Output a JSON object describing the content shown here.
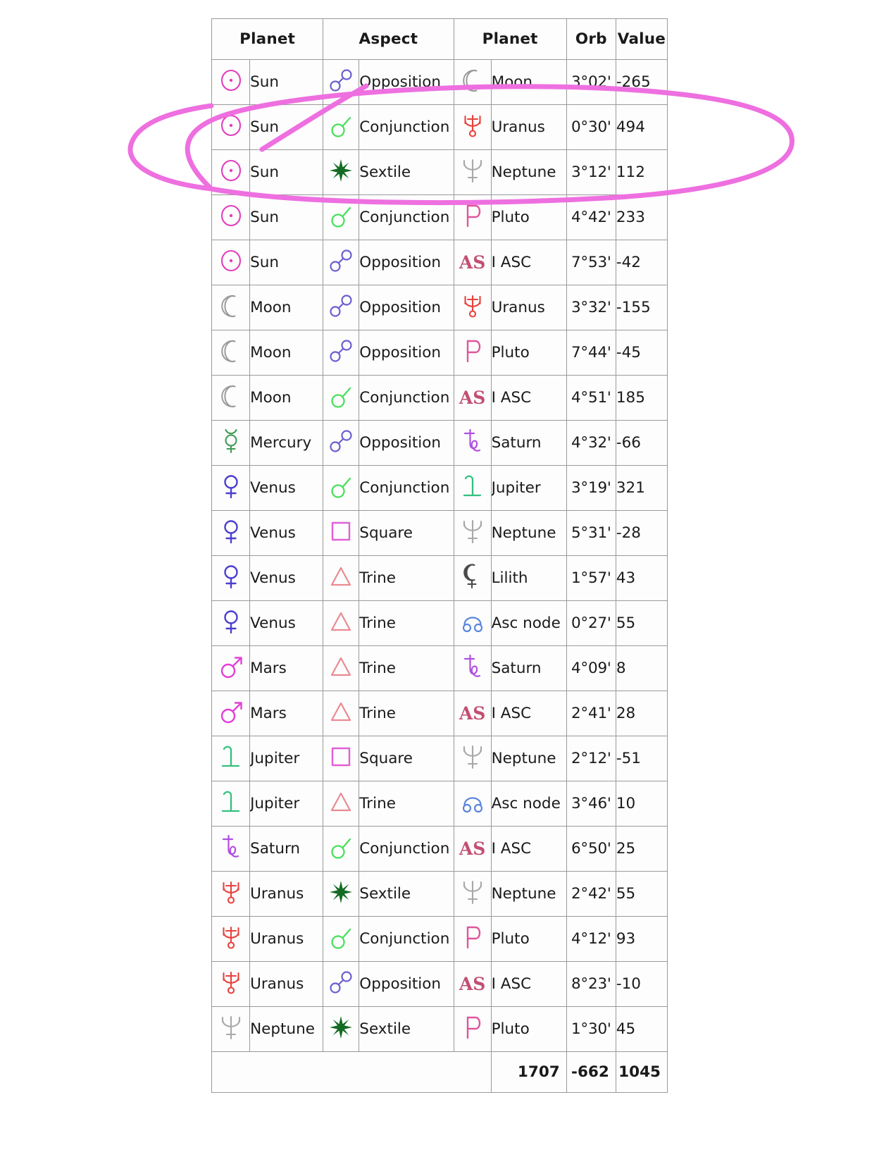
{
  "table": {
    "headers": [
      "Planet",
      "Aspect",
      "Planet",
      "Orb",
      "Value"
    ],
    "rows": [
      {
        "sym1": "sun",
        "planet1": "Sun",
        "aspect_sym": "opposition",
        "aspect": "Opposition",
        "sym2": "moon",
        "planet2": "Moon",
        "orb": "3°02'",
        "value": "-265"
      },
      {
        "sym1": "sun",
        "planet1": "Sun",
        "aspect_sym": "conjunction",
        "aspect": "Conjunction",
        "sym2": "uranus",
        "planet2": "Uranus",
        "orb": "0°30'",
        "value": "494"
      },
      {
        "sym1": "sun",
        "planet1": "Sun",
        "aspect_sym": "sextile",
        "aspect": "Sextile",
        "sym2": "neptune",
        "planet2": "Neptune",
        "orb": "3°12'",
        "value": "112"
      },
      {
        "sym1": "sun",
        "planet1": "Sun",
        "aspect_sym": "conjunction",
        "aspect": "Conjunction",
        "sym2": "pluto",
        "planet2": "Pluto",
        "orb": "4°42'",
        "value": "233"
      },
      {
        "sym1": "sun",
        "planet1": "Sun",
        "aspect_sym": "opposition",
        "aspect": "Opposition",
        "sym2": "asc",
        "planet2": "I ASC",
        "orb": "7°53'",
        "value": "-42"
      },
      {
        "sym1": "moon",
        "planet1": "Moon",
        "aspect_sym": "opposition",
        "aspect": "Opposition",
        "sym2": "uranus",
        "planet2": "Uranus",
        "orb": "3°32'",
        "value": "-155"
      },
      {
        "sym1": "moon",
        "planet1": "Moon",
        "aspect_sym": "opposition",
        "aspect": "Opposition",
        "sym2": "pluto",
        "planet2": "Pluto",
        "orb": "7°44'",
        "value": "-45"
      },
      {
        "sym1": "moon",
        "planet1": "Moon",
        "aspect_sym": "conjunction",
        "aspect": "Conjunction",
        "sym2": "asc",
        "planet2": "I ASC",
        "orb": "4°51'",
        "value": "185"
      },
      {
        "sym1": "mercury",
        "planet1": "Mercury",
        "aspect_sym": "opposition",
        "aspect": "Opposition",
        "sym2": "saturn",
        "planet2": "Saturn",
        "orb": "4°32'",
        "value": "-66"
      },
      {
        "sym1": "venus",
        "planet1": "Venus",
        "aspect_sym": "conjunction",
        "aspect": "Conjunction",
        "sym2": "jupiter",
        "planet2": "Jupiter",
        "orb": "3°19'",
        "value": "321"
      },
      {
        "sym1": "venus",
        "planet1": "Venus",
        "aspect_sym": "square",
        "aspect": "Square",
        "sym2": "neptune",
        "planet2": "Neptune",
        "orb": "5°31'",
        "value": "-28"
      },
      {
        "sym1": "venus",
        "planet1": "Venus",
        "aspect_sym": "trine",
        "aspect": "Trine",
        "sym2": "lilith",
        "planet2": "Lilith",
        "orb": "1°57'",
        "value": "43"
      },
      {
        "sym1": "venus",
        "planet1": "Venus",
        "aspect_sym": "trine",
        "aspect": "Trine",
        "sym2": "ascnode",
        "planet2": "Asc node",
        "orb": "0°27'",
        "value": "55"
      },
      {
        "sym1": "mars",
        "planet1": "Mars",
        "aspect_sym": "trine",
        "aspect": "Trine",
        "sym2": "saturn",
        "planet2": "Saturn",
        "orb": "4°09'",
        "value": "8"
      },
      {
        "sym1": "mars",
        "planet1": "Mars",
        "aspect_sym": "trine",
        "aspect": "Trine",
        "sym2": "asc",
        "planet2": "I ASC",
        "orb": "2°41'",
        "value": "28"
      },
      {
        "sym1": "jupiter",
        "planet1": "Jupiter",
        "aspect_sym": "square",
        "aspect": "Square",
        "sym2": "neptune",
        "planet2": "Neptune",
        "orb": "2°12'",
        "value": "-51"
      },
      {
        "sym1": "jupiter",
        "planet1": "Jupiter",
        "aspect_sym": "trine",
        "aspect": "Trine",
        "sym2": "ascnode",
        "planet2": "Asc node",
        "orb": "3°46'",
        "value": "10"
      },
      {
        "sym1": "saturn",
        "planet1": "Saturn",
        "aspect_sym": "conjunction",
        "aspect": "Conjunction",
        "sym2": "asc",
        "planet2": "I ASC",
        "orb": "6°50'",
        "value": "25"
      },
      {
        "sym1": "uranus",
        "planet1": "Uranus",
        "aspect_sym": "sextile",
        "aspect": "Sextile",
        "sym2": "neptune",
        "planet2": "Neptune",
        "orb": "2°42'",
        "value": "55"
      },
      {
        "sym1": "uranus",
        "planet1": "Uranus",
        "aspect_sym": "conjunction",
        "aspect": "Conjunction",
        "sym2": "pluto",
        "planet2": "Pluto",
        "orb": "4°12'",
        "value": "93"
      },
      {
        "sym1": "uranus",
        "planet1": "Uranus",
        "aspect_sym": "opposition",
        "aspect": "Opposition",
        "sym2": "asc",
        "planet2": "I ASC",
        "orb": "8°23'",
        "value": "-10"
      },
      {
        "sym1": "neptune",
        "planet1": "Neptune",
        "aspect_sym": "sextile",
        "aspect": "Sextile",
        "sym2": "pluto",
        "planet2": "Pluto",
        "orb": "1°30'",
        "value": "45"
      }
    ],
    "totals": {
      "positive_sum": "1707",
      "negative_sum": "-662",
      "net_total": "1045"
    }
  },
  "annotation": {
    "shape": "hand-drawn-ellipse",
    "color": "#ee6fe0",
    "highlighted_rows": [
      1,
      2,
      3
    ],
    "note": "pink marker ellipse encircling the Sun-Uranus and Sun-Neptune rows with a tail stroke"
  },
  "symbol_glyphs": {
    "sun": "☉",
    "moon": "☾",
    "mercury": "☿",
    "venus": "♀",
    "mars": "♂",
    "jupiter": "♃",
    "saturn": "♄",
    "uranus": "⛢",
    "neptune": "♆",
    "pluto": "♇",
    "lilith": "⚸",
    "ascnode": "☊",
    "asc": "AS",
    "opposition": "☍",
    "conjunction": "☌",
    "sextile": "⚹",
    "square": "□",
    "trine": "△"
  }
}
